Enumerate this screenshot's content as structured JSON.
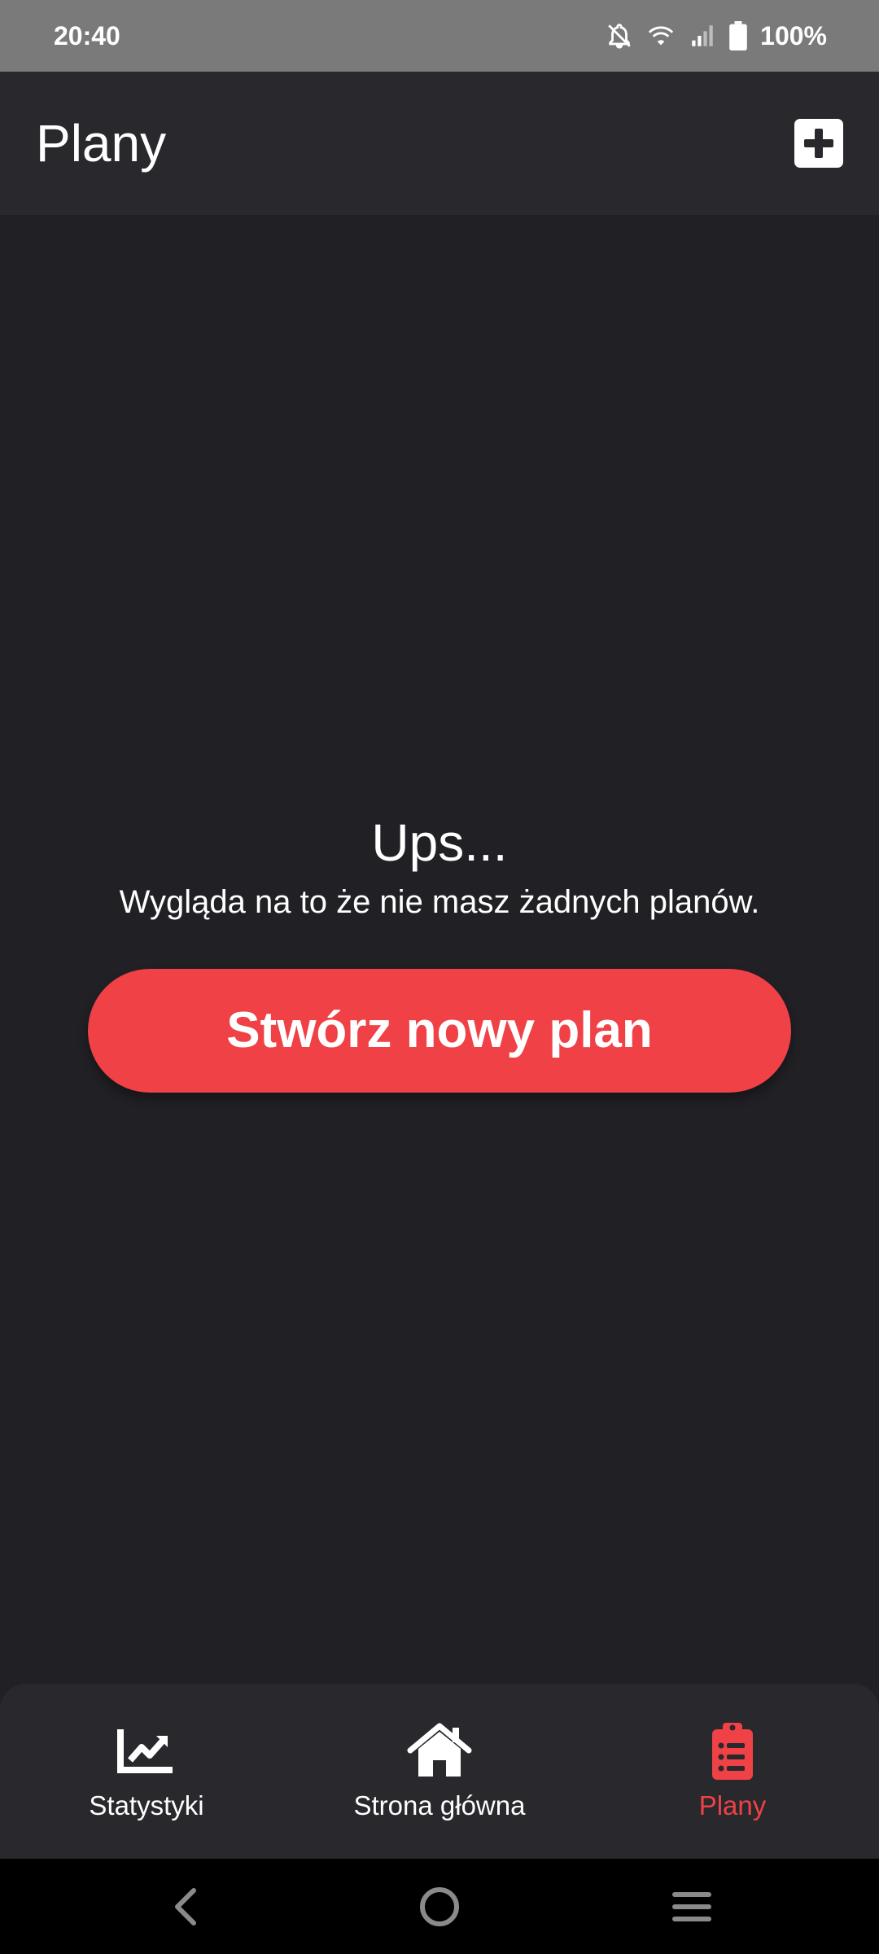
{
  "status_bar": {
    "time": "20:40",
    "battery_percent": "100%",
    "icons": [
      "bell-off-icon",
      "wifi-icon",
      "signal-icon",
      "battery-icon"
    ]
  },
  "header": {
    "title": "Plany",
    "add_icon": "plus-square-icon"
  },
  "empty_state": {
    "title": "Ups...",
    "message": "Wygląda na to że nie masz żadnych planów.",
    "button_label": "Stwórz nowy plan"
  },
  "bottom_nav": {
    "items": [
      {
        "label": "Statystyki",
        "icon": "chart-line-icon",
        "active": false
      },
      {
        "label": "Strona główna",
        "icon": "home-icon",
        "active": false
      },
      {
        "label": "Plany",
        "icon": "clipboard-list-icon",
        "active": true
      }
    ]
  },
  "system_nav": {
    "icons": [
      "back-icon",
      "home-circle-icon",
      "recents-icon"
    ]
  },
  "colors": {
    "accent": "#ef4146",
    "background": "#212025",
    "surface": "#28282d",
    "status_bar": "#7a7a7a"
  }
}
